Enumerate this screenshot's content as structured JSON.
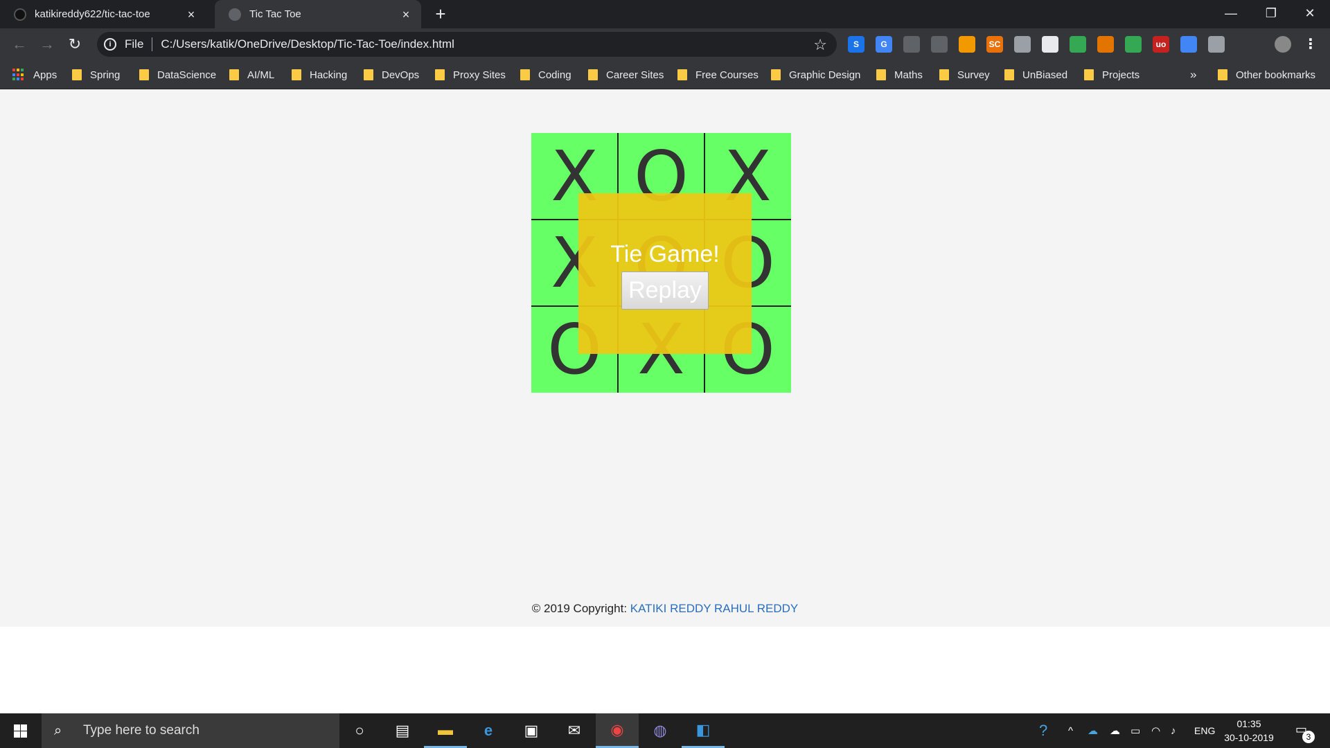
{
  "browser": {
    "tabs": [
      {
        "title": "katikireddy622/tic-tac-toe",
        "active": false
      },
      {
        "title": "Tic Tac Toe",
        "active": true
      }
    ],
    "new_tab": "+",
    "address": {
      "scheme": "File",
      "url": "C:/Users/katik/OneDrive/Desktop/Tic-Tac-Toe/index.html"
    },
    "bookmarks": [
      {
        "label": "Apps",
        "icon": "apps-grid-icon"
      },
      {
        "label": "Spring",
        "icon": "folder-icon"
      },
      {
        "label": "DataScience",
        "icon": "folder-icon"
      },
      {
        "label": "AI/ML",
        "icon": "folder-icon"
      },
      {
        "label": "Hacking",
        "icon": "folder-icon"
      },
      {
        "label": "DevOps",
        "icon": "folder-icon"
      },
      {
        "label": "Proxy Sites",
        "icon": "folder-icon"
      },
      {
        "label": "Coding",
        "icon": "folder-icon"
      },
      {
        "label": "Career Sites",
        "icon": "folder-icon"
      },
      {
        "label": "Free Courses",
        "icon": "folder-icon"
      },
      {
        "label": "Graphic Design",
        "icon": "folder-icon"
      },
      {
        "label": "Maths",
        "icon": "folder-icon"
      },
      {
        "label": "Survey",
        "icon": "folder-icon"
      },
      {
        "label": "UnBiased",
        "icon": "folder-icon"
      },
      {
        "label": "Projects",
        "icon": "folder-icon"
      }
    ],
    "bookmarks_overflow": "»",
    "other_bookmarks": "Other bookmarks",
    "extensions": [
      "S",
      "G",
      "",
      "",
      "",
      "SC",
      "",
      "",
      "",
      "",
      "",
      "uo",
      "",
      ""
    ]
  },
  "game": {
    "board": [
      "X",
      "O",
      "X",
      "X",
      "O",
      "O",
      "O",
      "X",
      "O"
    ],
    "result_text": "Tie Game!",
    "replay_label": "Replay",
    "colors": {
      "board": "#66ff66",
      "overlay": "#f0c814",
      "marks": "#333333",
      "link": "#2a6ebb"
    }
  },
  "footer": {
    "prefix": "© 2019 Copyright: ",
    "author": "KATIKI REDDY RAHUL REDDY"
  },
  "taskbar": {
    "search_placeholder": "Type here to search",
    "language": "ENG",
    "time": "01:35",
    "date": "30-10-2019",
    "notifications": "3"
  }
}
